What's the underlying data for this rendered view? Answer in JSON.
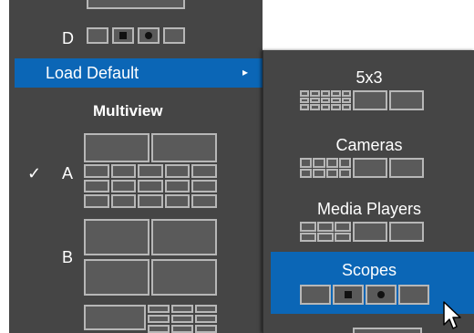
{
  "main_menu": {
    "row_d_letter": "D",
    "load_default_label": "Load Default",
    "submenu_arrow": "▸",
    "multiview_header": "Multiview",
    "checkmark": "✓",
    "row_a_letter": "A",
    "row_b_letter": "B"
  },
  "submenu": {
    "items": [
      {
        "label": "5x3"
      },
      {
        "label": "Cameras"
      },
      {
        "label": "Media Players"
      },
      {
        "label": "Scopes"
      }
    ]
  },
  "colors": {
    "menu_bg": "#454545",
    "highlight": "#0b66b6",
    "text": "#ffffff",
    "tile_stroke": "#b7b7b7"
  },
  "icons": [
    "checkmark-icon",
    "submenu-arrow-icon",
    "mouse-pointer-icon",
    "layout-thumbnail-icon"
  ]
}
